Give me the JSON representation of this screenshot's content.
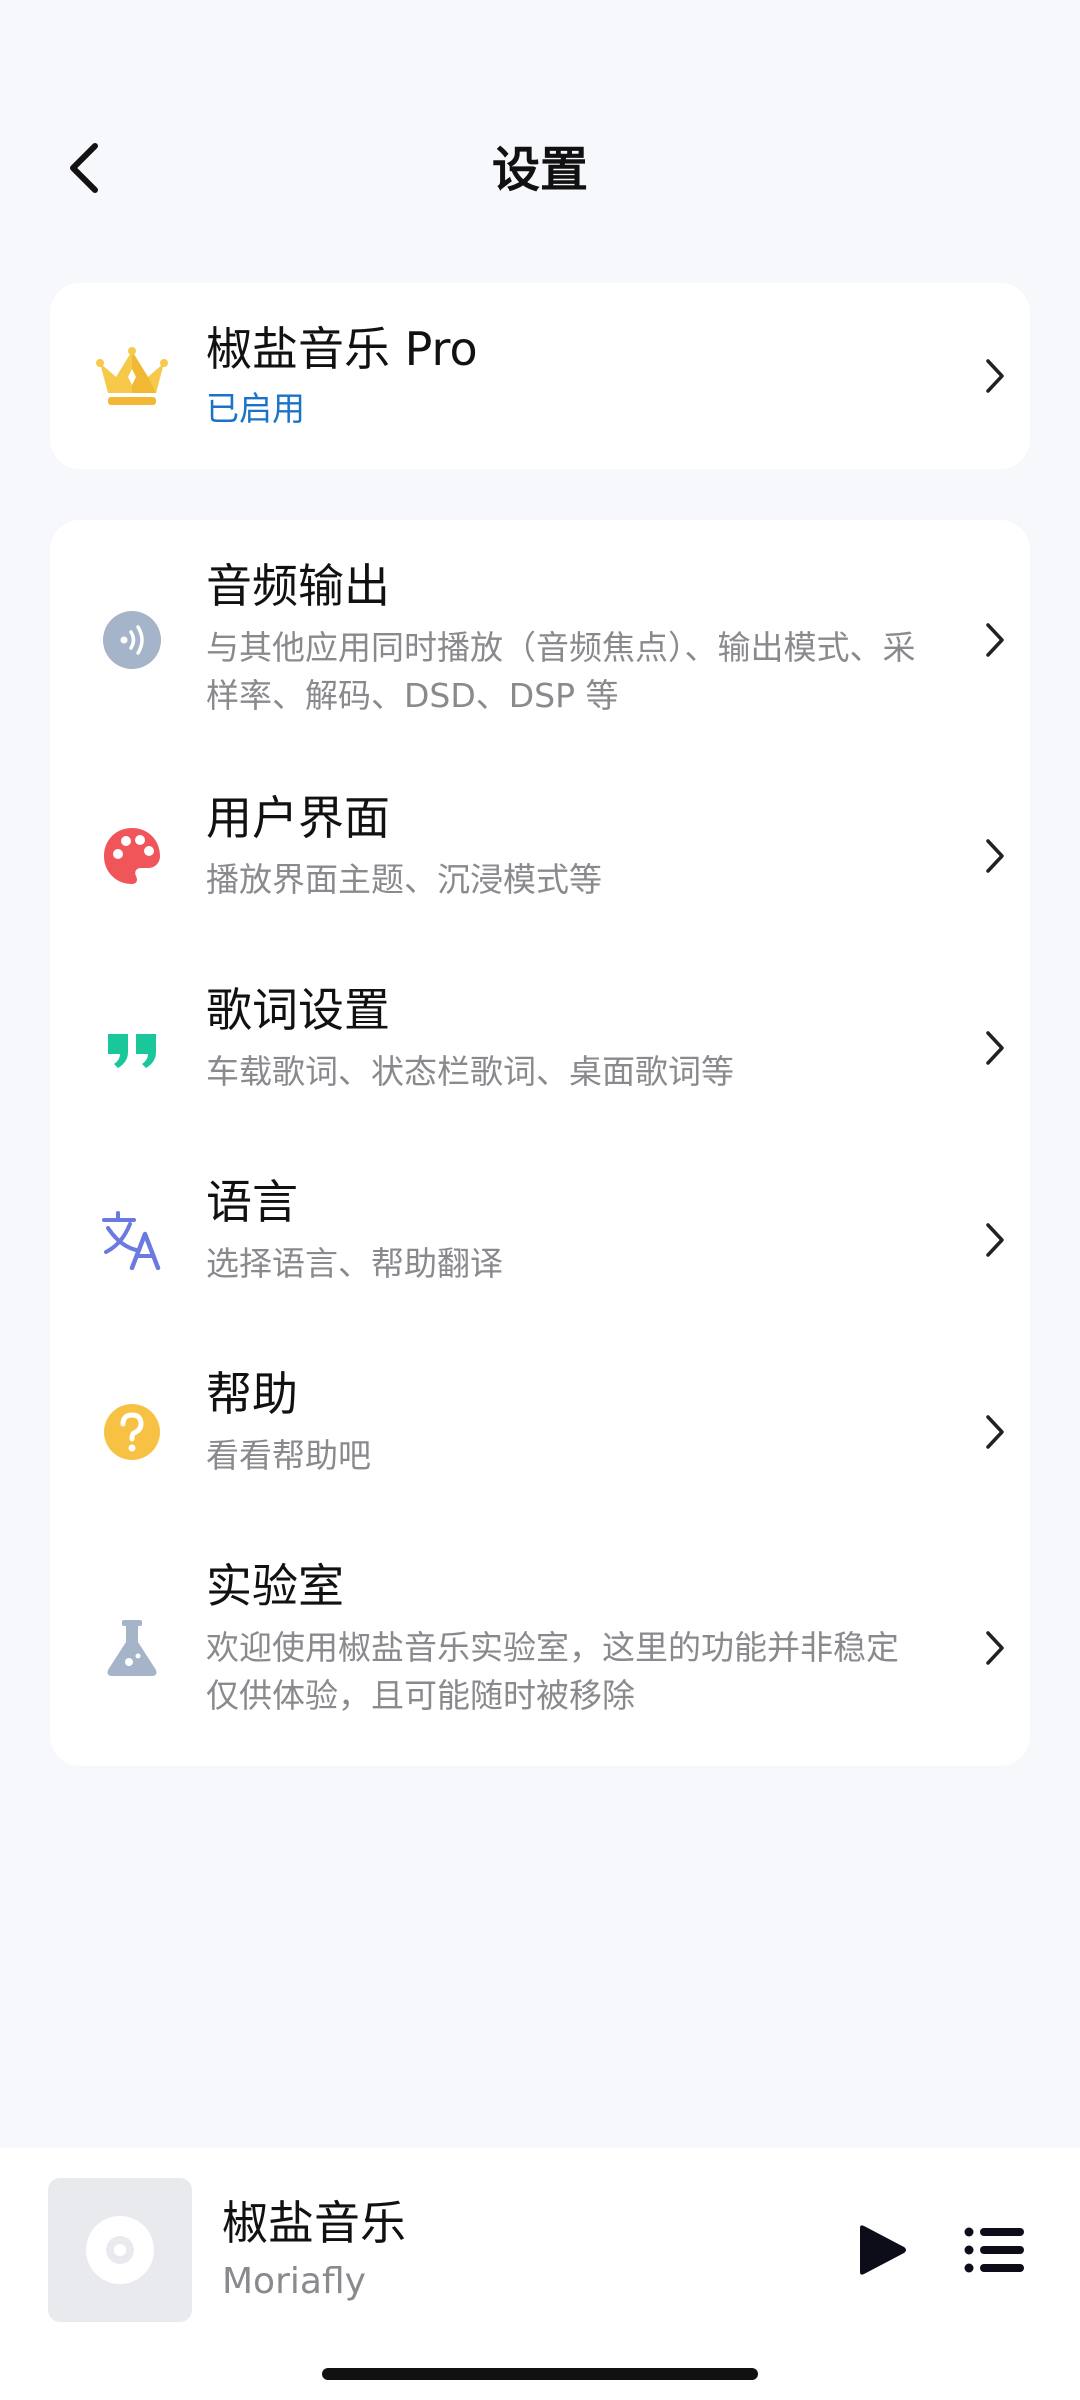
{
  "header": {
    "title": "设置"
  },
  "pro": {
    "title": "椒盐音乐 Pro",
    "status": "已启用"
  },
  "settings": [
    {
      "id": "audio",
      "title": "音频输出",
      "subtitle": "与其他应用同时播放（音频焦点）、输出模式、采样率、解码、DSD、DSP 等",
      "icon": "speaker-icon"
    },
    {
      "id": "ui",
      "title": "用户界面",
      "subtitle": "播放界面主题、沉浸模式等",
      "icon": "palette-icon"
    },
    {
      "id": "lyrics",
      "title": "歌词设置",
      "subtitle": "车载歌词、状态栏歌词、桌面歌词等",
      "icon": "quote-icon"
    },
    {
      "id": "language",
      "title": "语言",
      "subtitle": "选择语言、帮助翻译",
      "icon": "translate-icon"
    },
    {
      "id": "help",
      "title": "帮助",
      "subtitle": "看看帮助吧",
      "icon": "help-icon"
    },
    {
      "id": "lab",
      "title": "实验室",
      "subtitle": "欢迎使用椒盐音乐实验室，这里的功能并非稳定仅供体验，且可能随时被移除",
      "icon": "flask-icon"
    }
  ],
  "player": {
    "track_title": "椒盐音乐",
    "artist": "Moriafly"
  },
  "colors": {
    "accent": "#1a73c9",
    "background": "#f7f8fc",
    "card": "#ffffff",
    "subtitle": "#8a8a8e"
  }
}
